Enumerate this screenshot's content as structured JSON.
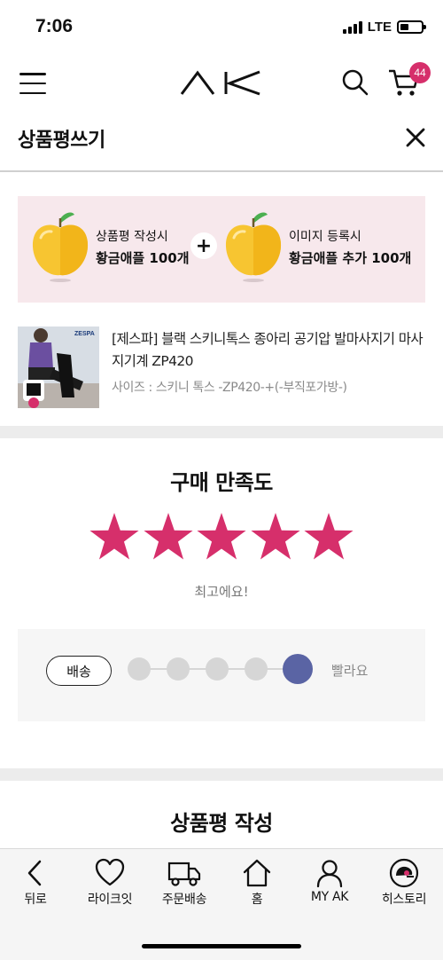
{
  "status_bar": {
    "time": "7:06",
    "network": "LTE"
  },
  "nav": {
    "logo_alt": "AK",
    "cart_count": "44"
  },
  "header": {
    "title": "상품평쓰기"
  },
  "promo": {
    "left": {
      "line1": "상품평 작성시",
      "line2": "황금애플 100개"
    },
    "plus": "+",
    "right": {
      "line1": "이미지 등록시",
      "line2": "황금애플 추가 100개"
    }
  },
  "product": {
    "name": "[제스파] 블랙 스키니톡스 종아리 공기압 발마사지기 마사지기계 ZP420",
    "option": "사이즈 : 스키니 톡스 -ZP420-+(-부직포가방-)",
    "thumb_brand": "ZESPA"
  },
  "rating": {
    "title": "구매 만족도",
    "value": 5,
    "max": 5,
    "label": "최고에요!",
    "star_color": "#d62f6b"
  },
  "delivery": {
    "tag": "배송",
    "level": 5,
    "levels": 5,
    "label": "빨라요",
    "active_color": "#5a64a4"
  },
  "review_section": {
    "title": "상품평 작성"
  },
  "tabbar": {
    "items": [
      {
        "icon": "chevron-left-icon",
        "label": "뒤로"
      },
      {
        "icon": "heart-icon",
        "label": "라이크잇"
      },
      {
        "icon": "truck-icon",
        "label": "주문배송"
      },
      {
        "icon": "home-icon",
        "label": "홈"
      },
      {
        "icon": "user-icon",
        "label": "MY AK"
      },
      {
        "icon": "history-icon",
        "label": "히스토리"
      }
    ]
  }
}
